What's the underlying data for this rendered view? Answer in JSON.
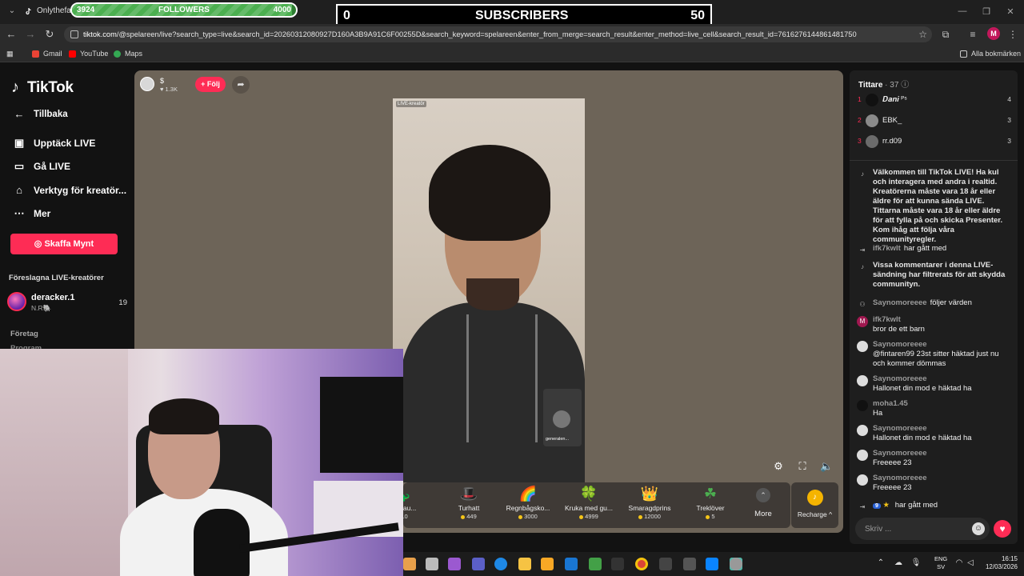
{
  "browser": {
    "tab_title": "Onlythefam",
    "url_domain": "tiktok.com",
    "url_rest": "/@spelareen/live?search_type=live&search_id=20260312080927D160A3B9A91C6F00255D&search_keyword=spelareen&enter_from_merge=search_result&enter_method=live_cell&search_result_id=7616276144861481750",
    "profile_initial": "M",
    "bookmarks": [
      "Gmail",
      "YouTube",
      "Maps"
    ],
    "all_bookmarks": "Alla bokmärken"
  },
  "overlays": {
    "followers": {
      "label": "FOLLOWERS",
      "current": "3924",
      "goal": "4000",
      "progress": 0.981
    },
    "subscribers": {
      "label": "SUBSCRIBERS",
      "current": "0",
      "goal": "50"
    }
  },
  "sidebar": {
    "logo": "TikTok",
    "back": "Tillbaka",
    "items": [
      {
        "label": "Upptäck LIVE",
        "icon": "calendar-live-icon"
      },
      {
        "label": "Gå LIVE",
        "icon": "video-camera-icon"
      },
      {
        "label": "Verktyg för kreatör...",
        "icon": "creator-tools-icon"
      },
      {
        "label": "Mer",
        "icon": "more-dots-icon"
      }
    ],
    "coins_button": "Skaffa Mynt",
    "suggested_title": "Föreslagna LIVE-kreatörer",
    "suggested": [
      {
        "name": "deracker.1",
        "sub": "N.R🐘",
        "count": "19"
      }
    ],
    "company": "Företag",
    "program": "Program"
  },
  "player": {
    "host_name": "$",
    "host_likes": "1.3K",
    "follow": "+ Följ",
    "live_tag": "LIVE-kreatör",
    "guest_name": "generalen...",
    "gifts": [
      {
        "name": "dinosau...",
        "price": "10",
        "icon": "🦕"
      },
      {
        "name": "Turhatt",
        "price": "449",
        "icon": "🎩"
      },
      {
        "name": "Regnbågsko...",
        "price": "3000",
        "icon": "🌈"
      },
      {
        "name": "Kruka med gu...",
        "price": "4999",
        "icon": "🍀"
      },
      {
        "name": "Smaragdprins",
        "price": "12000",
        "icon": "👑"
      },
      {
        "name": "Treklöver",
        "price": "5",
        "icon": "☘"
      }
    ],
    "more": "More",
    "recharge": "Recharge ^"
  },
  "chat": {
    "viewers_title": "Tittare",
    "viewers_count": "· 37",
    "top_viewers": [
      {
        "rank": "1",
        "name": "𝑫𝒂𝒏𝒊 ᴾˢ",
        "score": "4",
        "color": "#111111"
      },
      {
        "rank": "2",
        "name": "EBK_",
        "score": "3",
        "color": "#8a8a8a"
      },
      {
        "rank": "3",
        "name": "rr.d09",
        "score": "3",
        "color": "#6b6b6b"
      }
    ],
    "welcome": "Välkommen till TikTok LIVE! Ha kul och interagera med andra i realtid. Kreatörerna måste vara 18 år eller äldre för att kunna sända LIVE. Tittarna måste vara 18 år eller äldre för att fylla på och skicka Presenter. Kom ihåg att följa våra communityregler.",
    "join1_user": "ifk7kwlt",
    "join1_text": "har gått med",
    "filtered": "Vissa kommentarer i denna LIVE-sändning har filtrerats för att skydda communityn.",
    "follow_user": "Saynomoreeee",
    "follow_text": "följer värden",
    "messages": [
      {
        "user": "ifk7kwlt",
        "text": "bror de ett barn",
        "avatar": "M",
        "color": "#a01850"
      },
      {
        "user": "Saynomoreeee",
        "text": "@fintaren99 23st sitter häktad just nu och kommer dömmas",
        "avatar": "",
        "color": "#dddddd"
      },
      {
        "user": "Saynomoreeee",
        "text": "Hallonet din mod e häktad ha",
        "avatar": "",
        "color": "#dddddd"
      },
      {
        "user": "moha1.45",
        "text": "Ha",
        "avatar": "",
        "color": "#111111"
      },
      {
        "user": "Saynomoreeee",
        "text": "Hallonet din mod e häktad ha",
        "avatar": "",
        "color": "#dddddd"
      },
      {
        "user": "Saynomoreeee",
        "text": "Freeeee 23",
        "avatar": "",
        "color": "#dddddd"
      },
      {
        "user": "Saynomoreeee",
        "text": "Freeeee 23",
        "avatar": "",
        "color": "#dddddd"
      }
    ],
    "join2_level": "9",
    "join2_text": "har gått med",
    "placeholder": "Skriv ..."
  },
  "taskbar": {
    "lang_top": "ENG",
    "lang_bottom": "SV",
    "time": "16:15",
    "date": "12/03/2026"
  }
}
